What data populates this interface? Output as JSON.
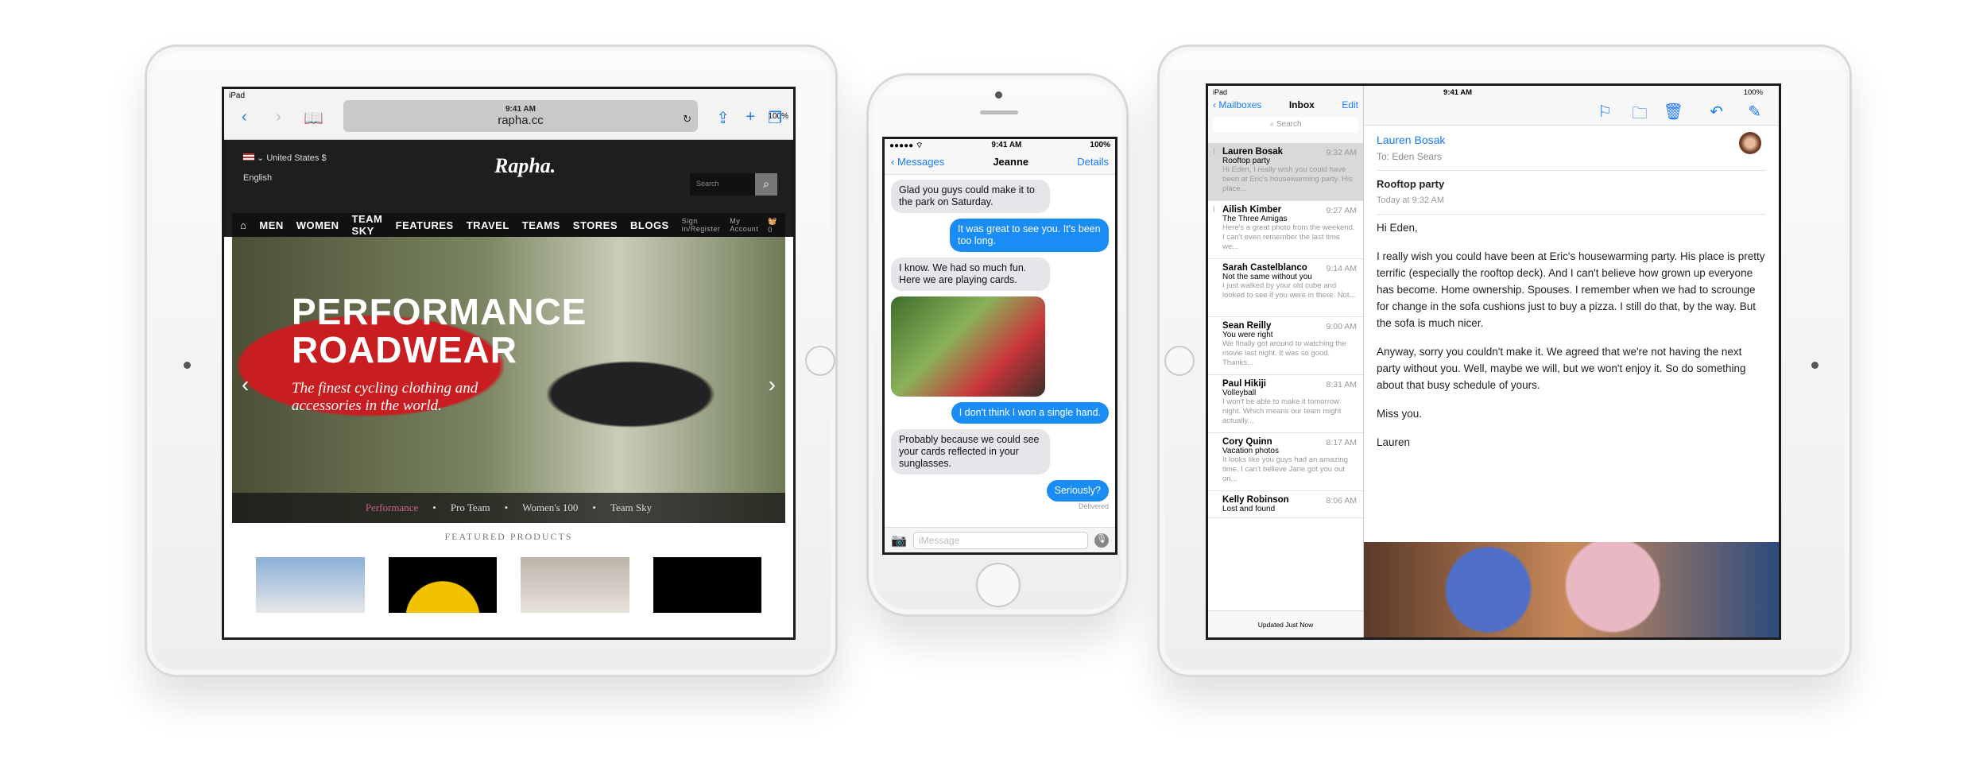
{
  "safari": {
    "carrier": "iPad",
    "time": "9:41 AM",
    "battery": "100%",
    "url": "rapha.cc",
    "rapha": {
      "region": "United States $",
      "language": "English",
      "logo": "Rapha.",
      "search_placeholder": "Search",
      "nav": [
        "MEN",
        "WOMEN",
        "TEAM SKY",
        "FEATURES",
        "TRAVEL",
        "TEAMS",
        "STORES",
        "BLOGS"
      ],
      "sign_in": "Sign in/Register",
      "account": "My Account",
      "basket_count": "0",
      "hero_title": "PERFORMANCE ROADWEAR",
      "hero_subtitle": "The finest cycling clothing and accessories in the world.",
      "hero_tabs": [
        "Performance",
        "Pro Team",
        "Women's 100",
        "Team Sky"
      ],
      "active_tab_color": "#d0608a",
      "featured": "FEATURED PRODUCTS"
    }
  },
  "messages": {
    "time": "9:41 AM",
    "battery": "100%",
    "back": "Messages",
    "contact": "Jeanne",
    "details": "Details",
    "bubbles": [
      {
        "dir": "in",
        "text": "Glad you guys could make it to the park on Saturday."
      },
      {
        "dir": "out",
        "text": "It was great to see you. It's been too long."
      },
      {
        "dir": "in",
        "text": "I know. We had so much fun. Here we are playing cards."
      },
      {
        "dir": "out",
        "text": "I don't think I won a single hand."
      },
      {
        "dir": "in",
        "text": "Probably because we could see your cards reflected in your sunglasses."
      },
      {
        "dir": "out",
        "text": "Seriously?"
      }
    ],
    "delivered": "Delivered",
    "input_placeholder": "iMessage",
    "accent": "#1a8cf6"
  },
  "mail": {
    "carrier": "iPad",
    "time": "9:41 AM",
    "battery": "100%",
    "back": "Mailboxes",
    "title": "Inbox",
    "edit": "Edit",
    "search": "Search",
    "messages": [
      {
        "from": "Lauren Bosak",
        "time": "9:32 AM",
        "subject": "Rooftop party",
        "preview": "Hi Eden, I really wish you could have been at Eric's housewarming party. His place..."
      },
      {
        "from": "Ailish Kimber",
        "time": "9:27 AM",
        "subject": "The Three Amigas",
        "preview": "Here's a great photo from the weekend. I can't even remember the last time we..."
      },
      {
        "from": "Sarah Castelblanco",
        "time": "9:14 AM",
        "subject": "Not the same without you",
        "preview": "I just walked by your old cube and looked to see if you were in there. Not..."
      },
      {
        "from": "Sean Reilly",
        "time": "9:00 AM",
        "subject": "You were right",
        "preview": "We finally got around to watching the movie last night. It was so good. Thanks..."
      },
      {
        "from": "Paul Hikiji",
        "time": "8:31 AM",
        "subject": "Volleyball",
        "preview": "I won't be able to make it tomorrow night. Which means our team might actually..."
      },
      {
        "from": "Cory Quinn",
        "time": "8:17 AM",
        "subject": "Vacation photos",
        "preview": "It looks like you guys had an amazing time. I can't believe Jane got you out on..."
      },
      {
        "from": "Kelly Robinson",
        "time": "8:06 AM",
        "subject": "Lost and found",
        "preview": ""
      }
    ],
    "updated": "Updated Just Now",
    "detail": {
      "from": "Lauren Bosak",
      "to": "To: Eden Sears",
      "subject": "Rooftop party",
      "date": "Today at 9:32 AM",
      "body": [
        "Hi Eden,",
        "I really wish you could have been at Eric's housewarming party. His place is pretty terrific (especially the rooftop deck). And I can't believe how grown up everyone has become. Home ownership. Spouses. I remember when we had to scrounge for change in the sofa cushions just to buy a pizza. I still do that, by the way. But the sofa is much nicer.",
        "Anyway, sorry you couldn't make it. We agreed that we're not having the next party without you. Well, maybe we will, but we won't enjoy it. So do something about that busy schedule of yours.",
        "Miss you.",
        "Lauren"
      ]
    }
  }
}
